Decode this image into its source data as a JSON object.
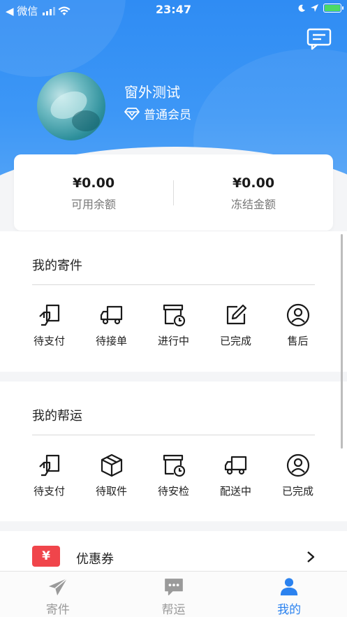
{
  "status_bar": {
    "back_app": "◀ 微信",
    "time": "23:47"
  },
  "profile": {
    "name": "窗外测试",
    "membership": "普通会员"
  },
  "balance": {
    "available_amount": "¥0.00",
    "available_label": "可用余额",
    "frozen_amount": "¥0.00",
    "frozen_label": "冻结金额"
  },
  "my_shipments": {
    "title": "我的寄件",
    "items": [
      {
        "label": "待支付",
        "icon": "pending-payment-icon"
      },
      {
        "label": "待接单",
        "icon": "truck-icon"
      },
      {
        "label": "进行中",
        "icon": "box-clock-icon"
      },
      {
        "label": "已完成",
        "icon": "edit-icon"
      },
      {
        "label": "售后",
        "icon": "user-service-icon"
      }
    ]
  },
  "my_deliveries": {
    "title": "我的帮运",
    "items": [
      {
        "label": "待支付",
        "icon": "pending-payment-icon"
      },
      {
        "label": "待取件",
        "icon": "package-icon"
      },
      {
        "label": "待安检",
        "icon": "box-clock-icon"
      },
      {
        "label": "配送中",
        "icon": "truck-icon"
      },
      {
        "label": "已完成",
        "icon": "user-service-icon"
      }
    ]
  },
  "coupon": {
    "icon_text": "¥",
    "label": "优惠券"
  },
  "tab_bar": {
    "tabs": [
      {
        "label": "寄件",
        "icon": "paper-plane-icon",
        "active": false
      },
      {
        "label": "帮运",
        "icon": "chat-dots-icon",
        "active": false
      },
      {
        "label": "我的",
        "icon": "user-icon",
        "active": true
      }
    ]
  },
  "colors": {
    "brand_blue": "#2f8cf3",
    "active_tab": "#2b82ef",
    "coupon_red": "#f0454b"
  }
}
